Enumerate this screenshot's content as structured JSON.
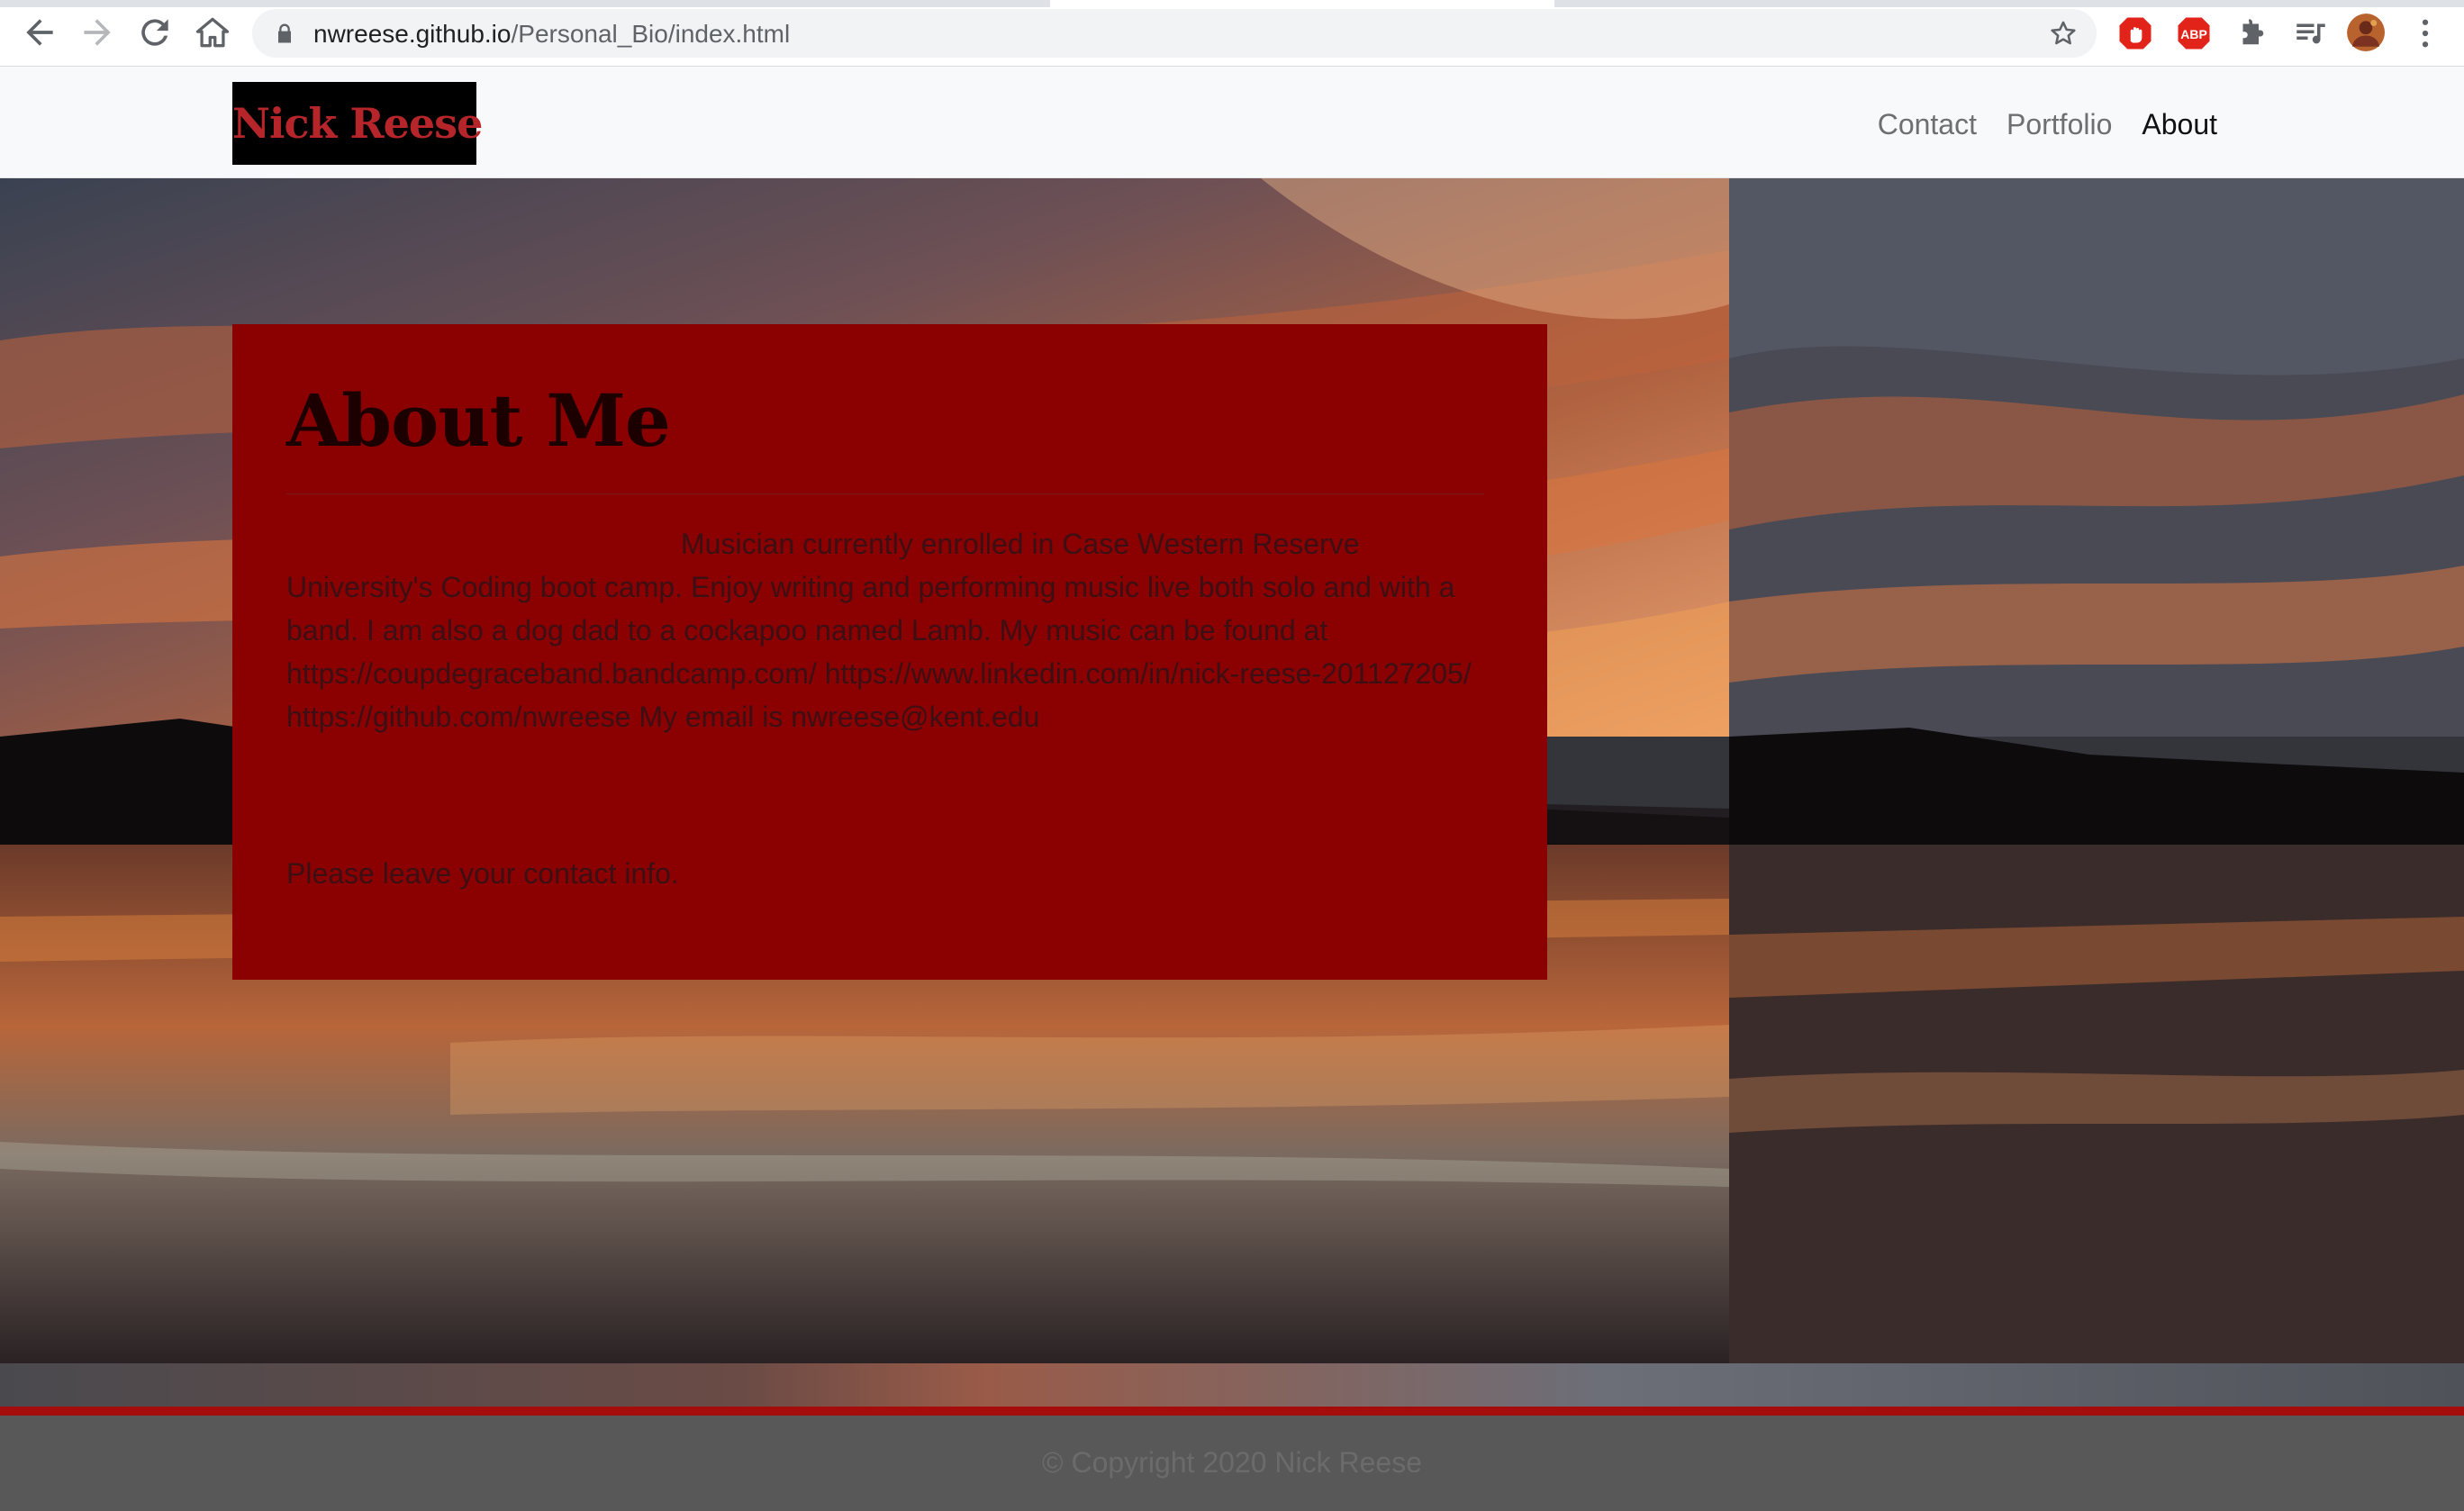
{
  "browser": {
    "url_host": "nwreese.github.io",
    "url_path": "/Personal_Bio/index.html"
  },
  "site": {
    "brand": "Nick Reese",
    "nav": [
      {
        "label": "Contact",
        "active": false
      },
      {
        "label": "Portfolio",
        "active": false
      },
      {
        "label": "About",
        "active": true
      }
    ]
  },
  "about": {
    "heading": "About Me",
    "bio": "Musician currently enrolled in Case Western Reserve University's Coding boot camp. Enjoy writing and performing music live both solo and with a band. I am also a dog dad to a cockapoo named Lamb. My music can be found at https://coupdegraceband.bandcamp.com/ https://www.linkedin.com/in/nick-reese-201127205/ https://github.com/nwreese My email is nwreese@kent.edu",
    "cta": "Please leave your contact info."
  },
  "footer": {
    "copyright": "© Copyright 2020 Nick Reese"
  },
  "colors": {
    "card": "#8b0000",
    "brand_text": "#b5252a",
    "accent_bar": "#a50c0c",
    "footer": "#585858"
  },
  "icons": [
    "back-arrow-icon",
    "forward-arrow-icon",
    "reload-icon",
    "home-icon",
    "lock-icon",
    "bookmark-star-icon",
    "adblock-hand-icon",
    "abp-icon",
    "extensions-puzzle-icon",
    "media-playlist-icon",
    "profile-avatar",
    "more-vert-icon"
  ]
}
